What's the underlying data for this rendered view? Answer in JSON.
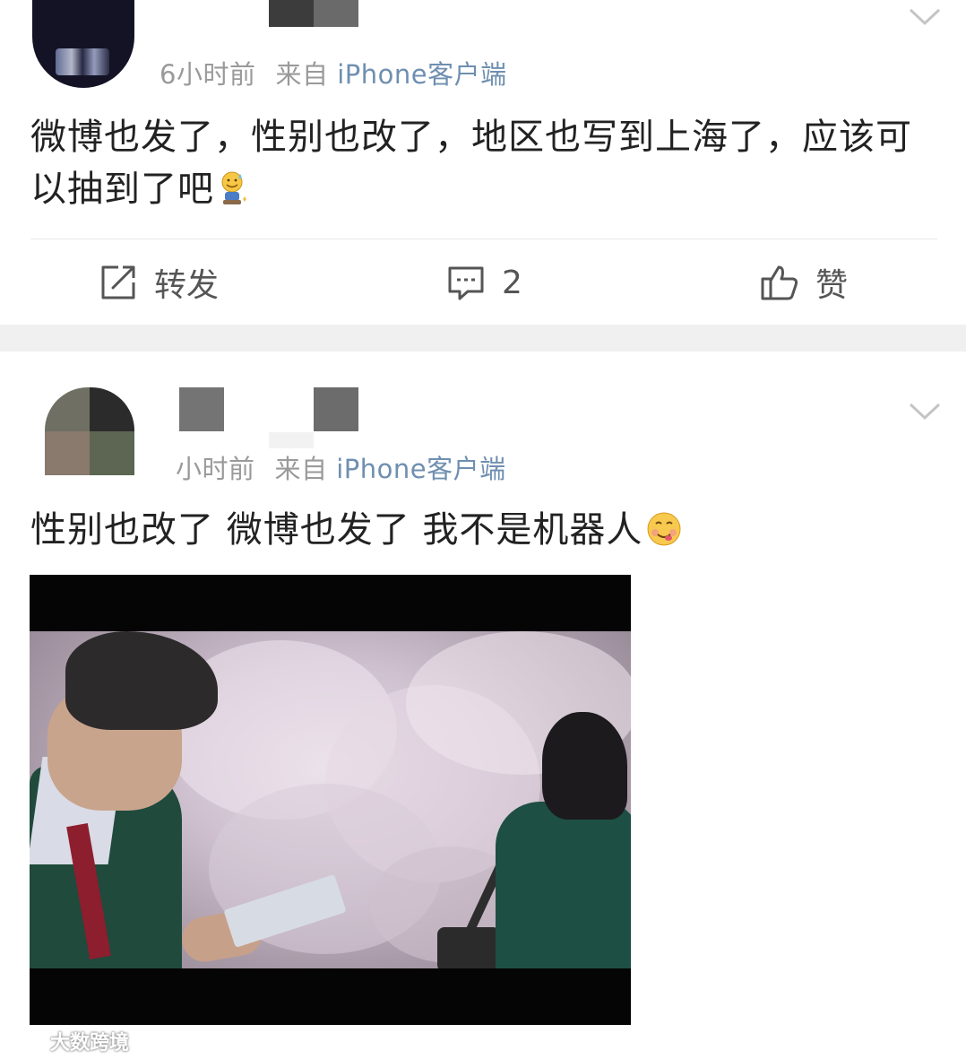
{
  "post1": {
    "time": "6小时前",
    "from_label": "来自",
    "source": "iPhone客户端",
    "text": "微博也发了，性别也改了，地区也写到上海了，应该可以抽到了吧",
    "actions": {
      "repost_label": "转发",
      "comment_count": "2",
      "like_label": "赞"
    }
  },
  "post2": {
    "time": "小时前",
    "from_label": "来自",
    "source": "iPhone客户端",
    "text": "性别也改了 微博也发了 我不是机器人"
  },
  "watermark": {
    "text": "大数跨境"
  },
  "icons": {
    "expand": "chevron-down-icon",
    "repost": "share-edit-icon",
    "comment": "comment-bubble-icon",
    "like": "thumbs-up-icon",
    "post1_emoji": "sweat-smile-emoji-icon",
    "post2_emoji": "yum-face-emoji-icon"
  },
  "colors": {
    "source_link": "#6f8fb0",
    "meta_gray": "#9a9a9a",
    "text": "#222222",
    "separator": "#f0f0f0"
  }
}
